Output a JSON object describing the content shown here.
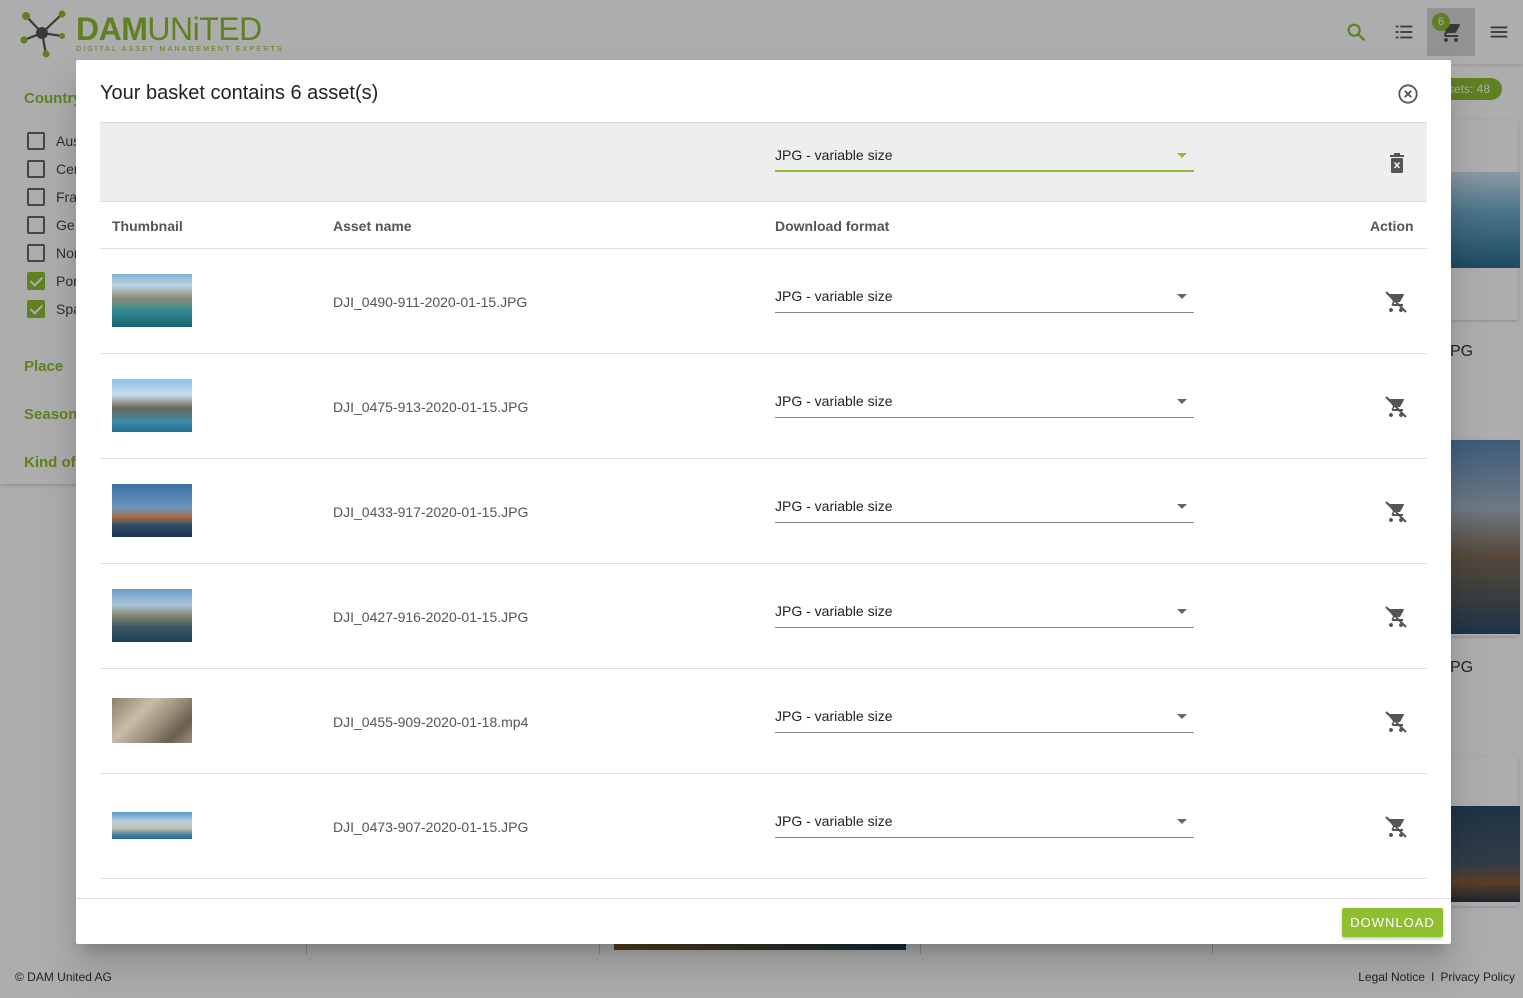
{
  "app": {
    "logo_main_1": "DAM",
    "logo_main_2": "UNiTED",
    "logo_sub": "DIGITAL ASSET MANAGEMENT EXPERTS",
    "brand_color": "#8dbf2e"
  },
  "topbar": {
    "icons": [
      "search-icon",
      "list-icon",
      "cart-icon",
      "menu-icon"
    ],
    "cart_count": "6"
  },
  "sidebar": {
    "sections": [
      "Country",
      "Place",
      "Season",
      "Kind of"
    ],
    "country_options": [
      {
        "label": "Aus",
        "checked": false
      },
      {
        "label": "Cen",
        "checked": false
      },
      {
        "label": "Fra",
        "checked": false
      },
      {
        "label": "Ge",
        "checked": false
      },
      {
        "label": "Nor",
        "checked": false
      },
      {
        "label": "Por",
        "checked": true
      },
      {
        "label": "Spa",
        "checked": true
      }
    ]
  },
  "results": {
    "assets_badge": "ssets: 48",
    "card_labels": [
      "PG",
      "PG"
    ]
  },
  "footer": {
    "copyright": "© DAM United AG",
    "legal": "Legal Notice",
    "separator": "I",
    "privacy": "Privacy Policy"
  },
  "modal": {
    "title": "Your basket contains 6 asset(s)",
    "bulk_format": "JPG - variable size",
    "columns": {
      "thumbnail": "Thumbnail",
      "asset_name": "Asset name",
      "download_format": "Download format",
      "action": "Action"
    },
    "rows": [
      {
        "name": "DJI_0490-911-2020-01-15.JPG",
        "format": "JPG - variable size"
      },
      {
        "name": "DJI_0475-913-2020-01-15.JPG",
        "format": "JPG - variable size"
      },
      {
        "name": "DJI_0433-917-2020-01-15.JPG",
        "format": "JPG - variable size"
      },
      {
        "name": "DJI_0427-916-2020-01-15.JPG",
        "format": "JPG - variable size"
      },
      {
        "name": "DJI_0455-909-2020-01-18.mp4",
        "format": "JPG - variable size"
      },
      {
        "name": "DJI_0473-907-2020-01-15.JPG",
        "format": "JPG - variable size"
      }
    ],
    "download_label": "DOWNLOAD"
  }
}
